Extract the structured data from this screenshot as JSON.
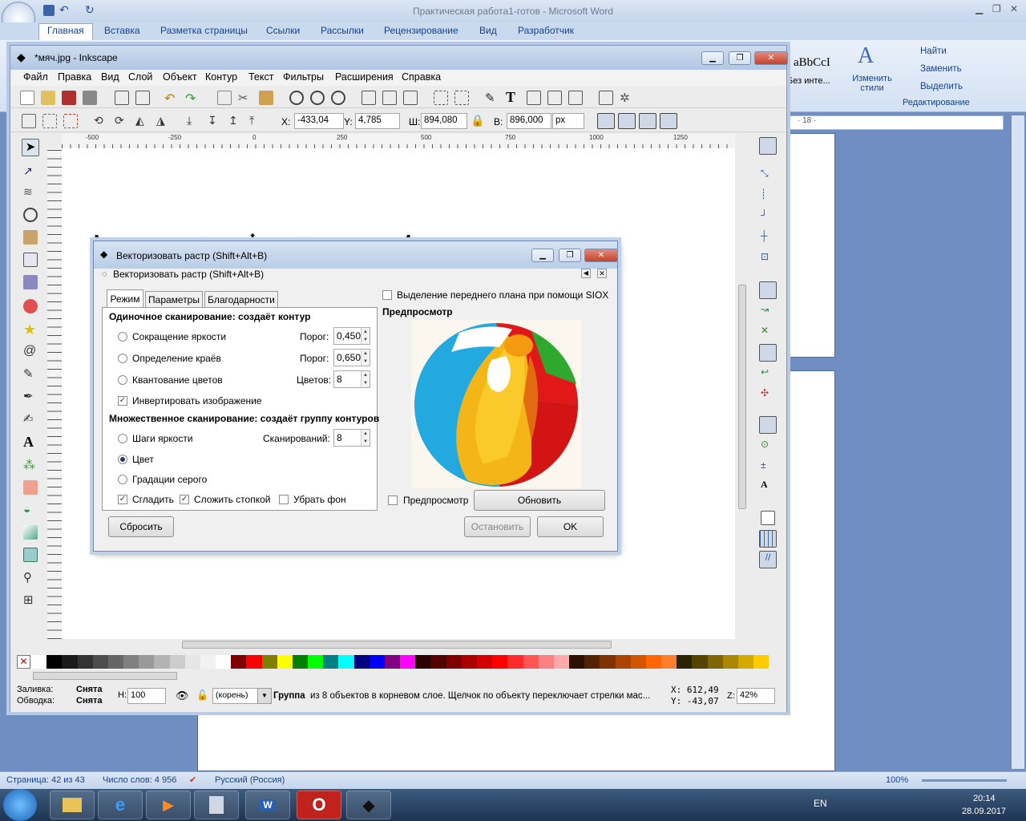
{
  "word": {
    "title": "Практическая работа1-готов - Microsoft Word",
    "tabs": [
      "Главная",
      "Вставка",
      "Разметка страницы",
      "Ссылки",
      "Рассылки",
      "Рецензирование",
      "Вид",
      "Разработчик"
    ],
    "styles_sample": "aBbCcI",
    "styles_sample2": "Без инте...",
    "change_styles": "Изменить стили",
    "find": "Найти",
    "replace": "Заменить",
    "select": "Выделить",
    "editing_group": "Редактирование",
    "ruler_mark": "· 18 ·",
    "status": {
      "page": "Страница: 42 из 43",
      "words": "Число слов: 4 956",
      "lang": "Русский (Россия)",
      "zoom": "100%"
    }
  },
  "inkscape": {
    "title": "*мяч.jpg - Inkscape",
    "menu": [
      "Файл",
      "Правка",
      "Вид",
      "Слой",
      "Объект",
      "Контур",
      "Текст",
      "Фильтры",
      "Расширения",
      "Справка"
    ],
    "x_label": "X:",
    "x_value": "-433,04",
    "y_label": "Y:",
    "y_value": "4,785",
    "w_label": "Ш:",
    "w_value": "894,080",
    "h_label": "В:",
    "h_value": "896,000",
    "unit": "px",
    "ruler_ticks": [
      "-500",
      "-250",
      "0",
      "250",
      "500",
      "750",
      "1000",
      "1250"
    ],
    "palette": [
      "#ffffff",
      "#000000",
      "#1a1a1a",
      "#333333",
      "#4d4d4d",
      "#666666",
      "#808080",
      "#999999",
      "#b3b3b3",
      "#cccccc",
      "#e6e6e6",
      "#f2f2f2",
      "#ffffff",
      "#800000",
      "#ff0000",
      "#808000",
      "#ffff00",
      "#008000",
      "#00ff00",
      "#008080",
      "#00ffff",
      "#000080",
      "#0000ff",
      "#800080",
      "#ff00ff",
      "#2b0000",
      "#550000",
      "#800000",
      "#aa0000",
      "#d40000",
      "#ff0000",
      "#ff2a2a",
      "#ff5555",
      "#ff8080",
      "#ffaaaa",
      "#2b1100",
      "#552200",
      "#803300",
      "#aa4400",
      "#d45500",
      "#ff6600",
      "#ff7f2a",
      "#2b2200",
      "#554400",
      "#806600",
      "#aa8800",
      "#d4aa00",
      "#ffcc00"
    ],
    "status": {
      "fill_label": "Заливка:",
      "fill_value": "Снята",
      "stroke_label": "Обводка:",
      "stroke_value": "Снята",
      "opacity_label": "Н:",
      "opacity_value": "100",
      "layer": "(корень)",
      "message_bold": "Группа",
      "message": "из 8 объектов в корневом слое. Щелчок по объекту переключает стрелки мас...",
      "cx": "X: 612,49",
      "cy": "Y: -43,07",
      "zoom_label": "Z:",
      "zoom_value": "42%"
    }
  },
  "dialog": {
    "window_title": "Векторизовать растр (Shift+Alt+B)",
    "panel_title": "Векторизовать растр (Shift+Alt+B)",
    "tabs": [
      "Режим",
      "Параметры",
      "Благодарности"
    ],
    "single_header": "Одиночное сканирование: создаёт контур",
    "brightness": "Сокращение яркости",
    "threshold_label": "Порог:",
    "brightness_value": "0,450",
    "edges": "Определение краёв",
    "edges_value": "0,650",
    "quant": "Квантование цветов",
    "colors_label": "Цветов:",
    "colors_value": "8",
    "invert": "Инвертировать изображение",
    "multi_header": "Множественное сканирование: создаёт группу контуров",
    "steps": "Шаги яркости",
    "scans_label": "Сканирований:",
    "scans_value": "8",
    "color": "Цвет",
    "gray": "Градации серого",
    "smooth": "Сгладить",
    "stack": "Сложить стопкой",
    "remove_bg": "Убрать фон",
    "siox": "Выделение переднего плана при помощи SIOX",
    "preview_header": "Предпросмотр",
    "preview_chk": "Предпросмотр",
    "update": "Обновить",
    "reset": "Сбросить",
    "stop": "Остановить",
    "ok": "OK"
  },
  "taskbar": {
    "lang": "EN",
    "time": "20:14",
    "date": "28.09.2017"
  }
}
